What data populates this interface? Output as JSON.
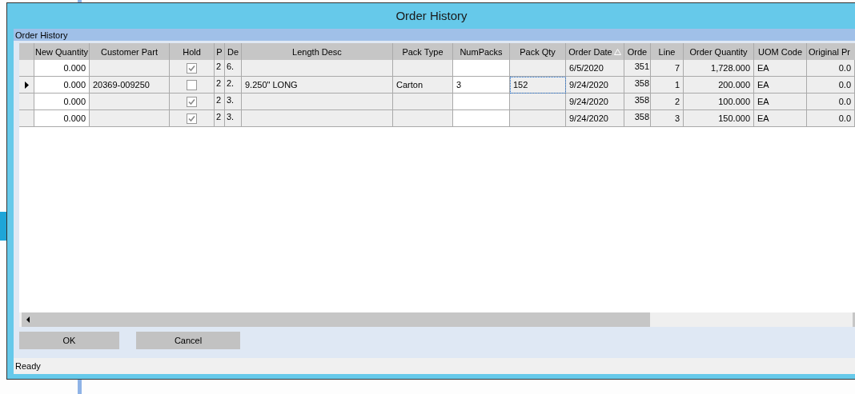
{
  "window": {
    "title": "Order History"
  },
  "group": {
    "title": "Order History"
  },
  "table": {
    "columns": [
      {
        "label": "New Quantity",
        "kind": "number",
        "editable": true,
        "sorted": false
      },
      {
        "label": "Customer Part",
        "kind": "text",
        "editable": false,
        "sorted": false
      },
      {
        "label": "Hold",
        "kind": "check",
        "editable": false,
        "sorted": false
      },
      {
        "label": "P",
        "kind": "short",
        "editable": false,
        "sorted": false
      },
      {
        "label": "De",
        "kind": "short",
        "editable": false,
        "sorted": false
      },
      {
        "label": "Length Desc",
        "kind": "text",
        "editable": false,
        "sorted": false
      },
      {
        "label": "Pack Type",
        "kind": "text",
        "editable": false,
        "sorted": false
      },
      {
        "label": "NumPacks",
        "kind": "text",
        "editable": true,
        "sorted": false
      },
      {
        "label": "Pack Qty",
        "kind": "text",
        "editable": false,
        "sorted": false
      },
      {
        "label": "Order Date",
        "kind": "text",
        "editable": false,
        "sorted": true
      },
      {
        "label": "Orde",
        "kind": "shortnum",
        "editable": false,
        "sorted": false
      },
      {
        "label": "Line",
        "kind": "number",
        "editable": false,
        "sorted": false
      },
      {
        "label": "Order Quantity",
        "kind": "number",
        "editable": false,
        "sorted": false
      },
      {
        "label": "UOM Code",
        "kind": "text",
        "editable": false,
        "sorted": false
      },
      {
        "label": "Original Pr",
        "kind": "number",
        "editable": false,
        "sorted": false
      }
    ],
    "rows": [
      {
        "selected": false,
        "cells": [
          "0.000",
          null,
          {
            "checked": true
          },
          "2",
          "6.",
          null,
          null,
          null,
          null,
          "6/5/2020",
          "351",
          "7",
          "1,728.000",
          "EA",
          "0.0"
        ]
      },
      {
        "selected": true,
        "cells": [
          "0.000",
          "20369-009250",
          {
            "checked": false
          },
          "2",
          "2.",
          "9.250\" LONG",
          "Carton",
          "3",
          {
            "text": "152",
            "focused": true
          },
          "9/24/2020",
          "358",
          "1",
          "200.000",
          "EA",
          "0.0"
        ]
      },
      {
        "selected": false,
        "cells": [
          "0.000",
          null,
          {
            "checked": true
          },
          "2",
          "3.",
          null,
          null,
          null,
          null,
          "9/24/2020",
          "358",
          "2",
          "100.000",
          "EA",
          "0.0"
        ]
      },
      {
        "selected": false,
        "cells": [
          "0.000",
          null,
          {
            "checked": true
          },
          "2",
          "3.",
          null,
          null,
          null,
          null,
          "9/24/2020",
          "358",
          "3",
          "150.000",
          "EA",
          "0.0"
        ]
      }
    ]
  },
  "buttons": [
    {
      "label": "OK"
    },
    {
      "label": "Cancel"
    }
  ],
  "status_bar": {
    "text": "Ready"
  }
}
